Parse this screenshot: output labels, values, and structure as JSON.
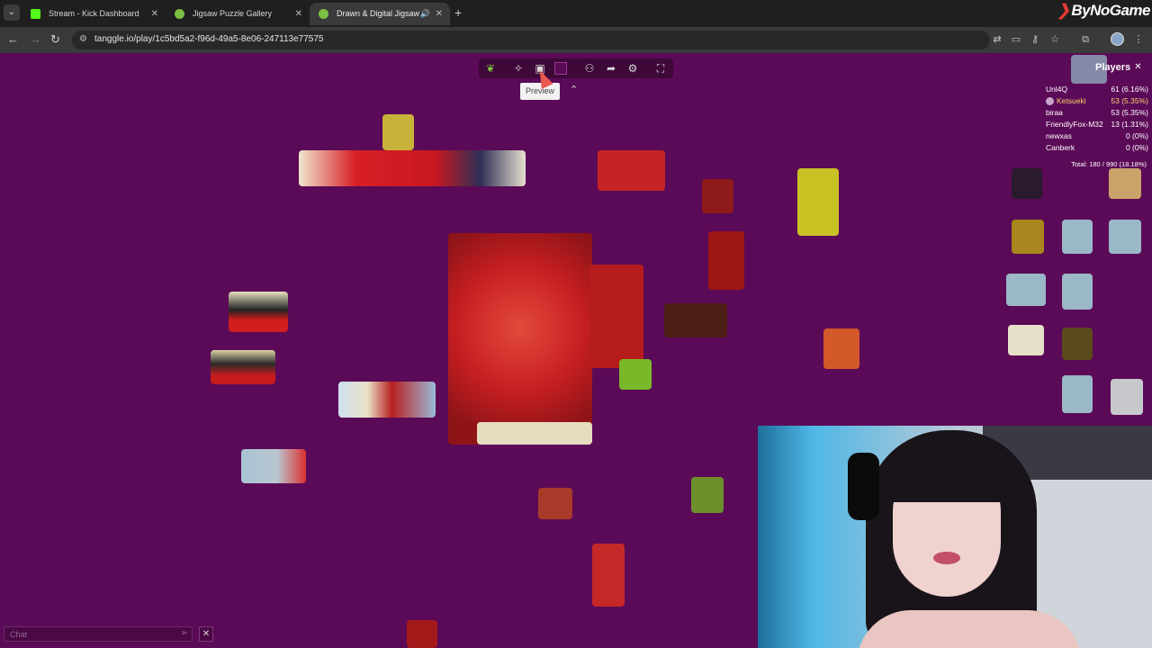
{
  "browser": {
    "tabs": [
      {
        "title": "Stream - Kick Dashboard",
        "favicon_color": "#53fc18",
        "active": false
      },
      {
        "title": "Jigsaw Puzzle Gallery",
        "favicon_color": "#7bc043",
        "active": false
      },
      {
        "title": "Drawn & Digital Jigsaw",
        "favicon_color": "#7bc043",
        "active": true
      }
    ],
    "url": "tanggle.io/play/1c5bd5a2-f96d-49a5-8e06-247113e77575",
    "brand": "ByNoGame"
  },
  "game": {
    "background_color": "#5b0a57",
    "toolbar": {
      "tools": [
        "leaf-icon",
        "puzzle-outline-icon",
        "preview-icon",
        "color-swatch-icon",
        "players-icon",
        "share-icon",
        "settings-icon",
        "fullscreen-icon"
      ],
      "tooltip": "Preview"
    },
    "players_panel": {
      "title": "Players",
      "players": [
        {
          "name": "Unl4Q",
          "score": "61 (6.16%)",
          "highlight": false
        },
        {
          "name": "Ketsueki",
          "score": "53 (5.35%)",
          "highlight": true
        },
        {
          "name": "biraa",
          "score": "53 (5.35%)",
          "highlight": false
        },
        {
          "name": "FriendlyFox-M32",
          "score": "13 (1.31%)",
          "highlight": false
        },
        {
          "name": "newxas",
          "score": "0 (0%)",
          "highlight": false
        },
        {
          "name": "Canberk",
          "score": "0 (0%)",
          "highlight": false
        }
      ],
      "total": "Total: 180 / 990 (18.18%)"
    },
    "chat": {
      "placeholder": "Chat"
    }
  }
}
